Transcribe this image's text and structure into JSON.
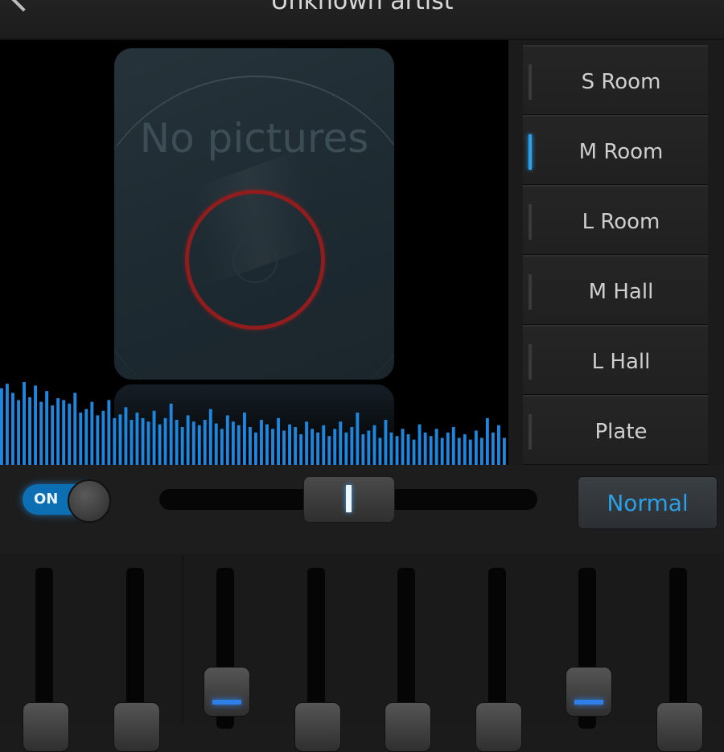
{
  "header": {
    "title": "Unknown artist"
  },
  "album": {
    "placeholder_text": "No pictures"
  },
  "presets": [
    {
      "label": "S Room",
      "active": false
    },
    {
      "label": "M Room",
      "active": true
    },
    {
      "label": "L Room",
      "active": false
    },
    {
      "label": "M Hall",
      "active": false
    },
    {
      "label": "L Hall",
      "active": false
    },
    {
      "label": "Plate",
      "active": false
    }
  ],
  "controls": {
    "toggle_label": "ON",
    "toggle_state": true,
    "balance_level": 0.5,
    "mode_label": "Normal"
  },
  "equalizer": {
    "bands": [
      {
        "level": 0.05,
        "active": false
      },
      {
        "level": 0.05,
        "active": false
      },
      {
        "level": 0.25,
        "active": true
      },
      {
        "level": 0.05,
        "active": false
      },
      {
        "level": 0.05,
        "active": false
      },
      {
        "level": 0.05,
        "active": false
      },
      {
        "level": 0.25,
        "active": true
      },
      {
        "level": 0.05,
        "active": false
      }
    ]
  },
  "visualizer": {
    "color": "#1e86dc",
    "levels": [
      0.85,
      0.9,
      0.8,
      0.72,
      0.92,
      0.75,
      0.88,
      0.7,
      0.82,
      0.66,
      0.74,
      0.72,
      0.68,
      0.8,
      0.58,
      0.62,
      0.7,
      0.55,
      0.6,
      0.72,
      0.52,
      0.56,
      0.64,
      0.5,
      0.58,
      0.52,
      0.48,
      0.6,
      0.45,
      0.52,
      0.68,
      0.5,
      0.42,
      0.55,
      0.48,
      0.44,
      0.5,
      0.62,
      0.46,
      0.4,
      0.55,
      0.48,
      0.44,
      0.58,
      0.42,
      0.36,
      0.5,
      0.45,
      0.4,
      0.52,
      0.38,
      0.45,
      0.42,
      0.34,
      0.48,
      0.4,
      0.36,
      0.44,
      0.32,
      0.4,
      0.48,
      0.36,
      0.42,
      0.58,
      0.34,
      0.38,
      0.44,
      0.3,
      0.5,
      0.36,
      0.32,
      0.4,
      0.34,
      0.28,
      0.45,
      0.36,
      0.32,
      0.4,
      0.3,
      0.36,
      0.42,
      0.3,
      0.34,
      0.28,
      0.38,
      0.3,
      0.52,
      0.36,
      0.44,
      0.3
    ]
  }
}
